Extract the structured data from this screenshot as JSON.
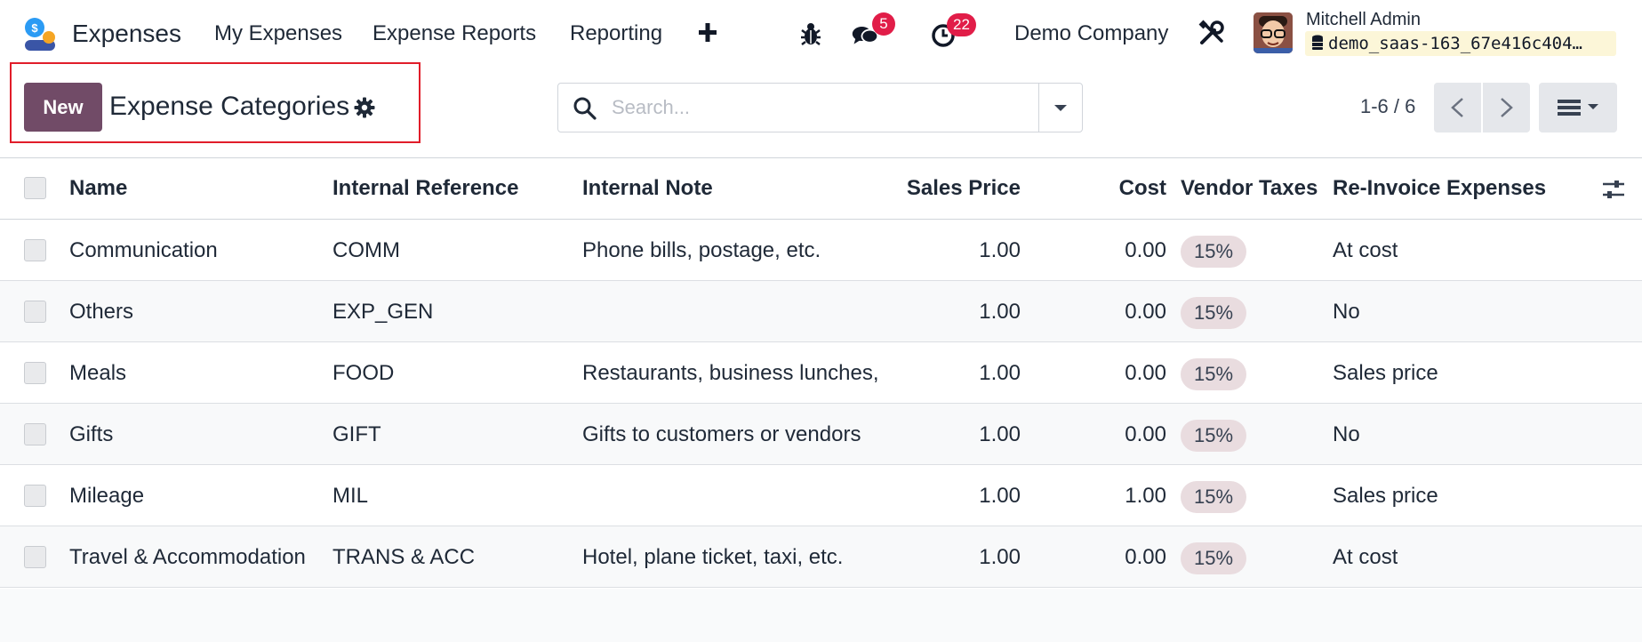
{
  "navbar": {
    "app_name": "Expenses",
    "menus": [
      "My Expenses",
      "Expense Reports",
      "Reporting"
    ],
    "messages_count": "5",
    "activities_count": "22",
    "company": "Demo Company",
    "user_name": "Mitchell Admin",
    "database": "demo_saas-163_67e416c404…",
    "icons": [
      "expenses-app-icon",
      "plus-icon",
      "bug-icon",
      "chat-icon",
      "clock-icon",
      "tools-icon",
      "avatar",
      "database-icon"
    ]
  },
  "control_panel": {
    "new_label": "New",
    "title": "Expense Categories",
    "search_placeholder": "Search...",
    "pager": "1-6 / 6"
  },
  "table": {
    "columns": [
      "Name",
      "Internal Reference",
      "Internal Note",
      "Sales Price",
      "Cost",
      "Vendor Taxes",
      "Re-Invoice Expenses"
    ],
    "rows": [
      {
        "name": "Communication",
        "ref": "COMM",
        "note": "Phone bills, postage, etc.",
        "price": "1.00",
        "cost": "0.00",
        "tax": "15%",
        "reinvoice": "At cost"
      },
      {
        "name": "Others",
        "ref": "EXP_GEN",
        "note": "",
        "price": "1.00",
        "cost": "0.00",
        "tax": "15%",
        "reinvoice": "No"
      },
      {
        "name": "Meals",
        "ref": "FOOD",
        "note": "Restaurants, business lunches,",
        "price": "1.00",
        "cost": "0.00",
        "tax": "15%",
        "reinvoice": "Sales price"
      },
      {
        "name": "Gifts",
        "ref": "GIFT",
        "note": "Gifts to customers or vendors",
        "price": "1.00",
        "cost": "0.00",
        "tax": "15%",
        "reinvoice": "No"
      },
      {
        "name": "Mileage",
        "ref": "MIL",
        "note": "",
        "price": "1.00",
        "cost": "1.00",
        "tax": "15%",
        "reinvoice": "Sales price"
      },
      {
        "name": "Travel & Accommodation",
        "ref": "TRANS & ACC",
        "note": "Hotel, plane ticket, taxi, etc.",
        "price": "1.00",
        "cost": "0.00",
        "tax": "15%",
        "reinvoice": "At cost"
      }
    ]
  },
  "colors": {
    "brand": "#714b67",
    "badge": "#e11d48",
    "highlight": "#e11d2a",
    "tag_bg": "#e9dcdf",
    "db_chip": "#fcf6d8"
  }
}
